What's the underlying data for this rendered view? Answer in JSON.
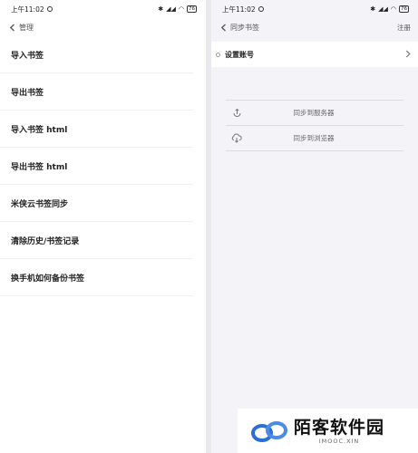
{
  "left_screen": {
    "status": {
      "time": "上午11:02",
      "battery": "76"
    },
    "nav": {
      "title": "管理"
    },
    "menu_items": [
      {
        "label": "导入书签"
      },
      {
        "label": "导出书签"
      },
      {
        "label": "导入书签 html"
      },
      {
        "label": "导出书签 html"
      },
      {
        "label": "米侠云书签同步"
      },
      {
        "label": "清除历史/书签记录"
      },
      {
        "label": "换手机如何备份书签"
      }
    ]
  },
  "right_screen": {
    "status": {
      "time": "上午11:02",
      "battery": "76"
    },
    "nav": {
      "title": "同步书签",
      "action": "注册"
    },
    "account": {
      "label": "设置账号"
    },
    "sync_options": [
      {
        "label": "同步到服务器",
        "icon": "upload-icon"
      },
      {
        "label": "同步到浏览器",
        "icon": "cloud-download-icon"
      }
    ]
  },
  "watermark": {
    "title": "陌客软件园",
    "subtitle": "IMOOC.XIN"
  },
  "colors": {
    "left_bg": "#ffffff",
    "right_bg": "#f4f4f8",
    "gap_bg": "#e9e9ee",
    "logo_blue": "#2b6fd6"
  }
}
